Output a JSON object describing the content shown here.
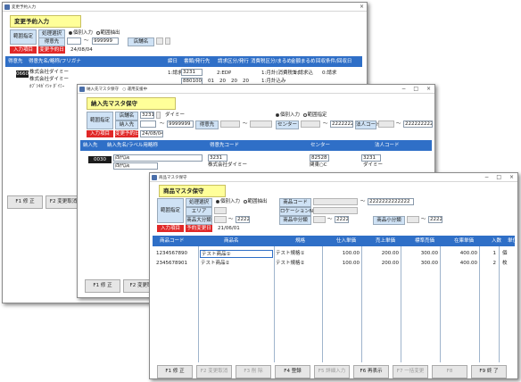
{
  "win1": {
    "title": "変更予約入力",
    "controls": {
      "min": "",
      "max": "",
      "close": "×"
    },
    "heading": "変更予約入力",
    "range_label": "範囲指定",
    "proc_label": "処理選択",
    "opt_individual": "個別入力",
    "opt_range": "範囲抽出",
    "dest_label": "得意先",
    "dest_to_prefix": "〜",
    "dest_to": "999999",
    "store_label": "店舗名",
    "input_item_label": "入力項目",
    "change_date_label": "変更予約日",
    "change_date": "24/08/04",
    "header_cols": [
      "得意先",
      "得意先名/略称/フリガナ",
      "締日",
      "書類/発行先",
      "請求区分/発行",
      "消費税区分/まるめ",
      "金額まるめ",
      "回収条件/回収日"
    ],
    "code": "0660",
    "name1": "株式会社ダイミー",
    "name2": "株式会社ダイミー",
    "kana": "ｶﾌﾞｼｷｶﾞｲｼｬ ﾀﾞｲﾐｰ",
    "col3_1": "1:請求",
    "col3_2": "3231",
    "col4": "2:EDP",
    "col4b": "880100",
    "nums": [
      "01",
      "20",
      "20",
      "20"
    ],
    "col5": "1:月計(消費税計)",
    "col6": "1:請求込",
    "col7": "0:請求",
    "col5b": "1:月計込み",
    "fkeys": [
      "F1 修 正",
      "F2 変更取消"
    ]
  },
  "win2": {
    "title": "納入先マスタ保守",
    "subtitle": "○ 運用支援中",
    "controls": {
      "min": "−",
      "max": "□",
      "close": "×"
    },
    "heading": "納入先マスタ保守",
    "range_label": "範囲指定",
    "store_label": "店舗名",
    "store_code": "3231",
    "store_name": "ダイミー",
    "deliv_label": "納入先",
    "from_label": "〜",
    "from_val": "9999999",
    "dest_label": "得意先",
    "dest_to": "〜",
    "opt_individual": "個別入力",
    "opt_range": "範囲指定",
    "center_label": "センター",
    "center_to": "〜",
    "center_val": "2222222",
    "corp_label": "法人コード",
    "corp_to": "〜",
    "corp_val": "2222222222222",
    "input_item_label": "入力項目",
    "change_date_label": "変更予約日",
    "change_date": "24/08/04",
    "header_cols": [
      "納入先",
      "納入先名/ラベル用略称",
      "得意先コード",
      "センター",
      "法人コード"
    ],
    "code": "0030",
    "name1": "西代店",
    "name2": "西代店",
    "dest_code": "3231",
    "dest_name": "株式会社ダイミー",
    "center_code": "82528",
    "center_name": "関東○C",
    "corp_code": "3231",
    "corp_name": "ダイミー",
    "fkeys": [
      "F1 修 正",
      "F2 変更取"
    ]
  },
  "win3": {
    "title": "商品マスタ保守",
    "controls": {
      "min": "−",
      "max": "□",
      "close": "×"
    },
    "heading": "商品マスタ保守",
    "range_label": "範囲指定",
    "proc_label": "処理選択",
    "opt_individual": "個別入力",
    "opt_range": "範囲抽出",
    "area_label": "エリア",
    "cat_big_label": "商品大分類",
    "cat_big_to": "〜",
    "cat_big_val": "2222",
    "prod_code_label": "商品コード",
    "prod_code_to": "〜",
    "prod_code_val": "2222222222222",
    "loc_label": "ロケーションNo.",
    "cat_mid_label": "商品中分類",
    "cat_mid_to": "〜",
    "cat_mid_val": "2222",
    "cat_small_label": "商品小分類",
    "cat_small_to": "〜",
    "cat_small_val": "2222",
    "input_item_label": "入力項目",
    "change_date_label": "予約変更日",
    "change_date": "21/06/01",
    "header_cols": [
      "商品コード",
      "商品名",
      "規格",
      "仕入単価",
      "売上単価",
      "標準売価",
      "在庫単価",
      "入数",
      "単位"
    ],
    "rows": [
      {
        "code": "1234567890",
        "name": "テスト商品①",
        "spec": "テスト規格①",
        "cost": "100.00",
        "sale": "200.00",
        "std": "300.00",
        "stock": "400.00",
        "qty": "1",
        "unit": "個"
      },
      {
        "code": "2345678901",
        "name": "テスト商品②",
        "spec": "テスト規格②",
        "cost": "100.00",
        "sale": "200.00",
        "std": "300.00",
        "stock": "400.00",
        "qty": "2",
        "unit": "枚"
      }
    ],
    "fkeys": [
      "F1 修 正",
      "F2 変更取消",
      "F3 削 除",
      "F4 登録",
      "F5 詳細入力",
      "F6 再表示",
      "F7 一括変更",
      "F8",
      "F9 終 了"
    ],
    "fkeys_enabled": [
      true,
      false,
      false,
      true,
      false,
      true,
      false,
      false,
      true
    ]
  }
}
